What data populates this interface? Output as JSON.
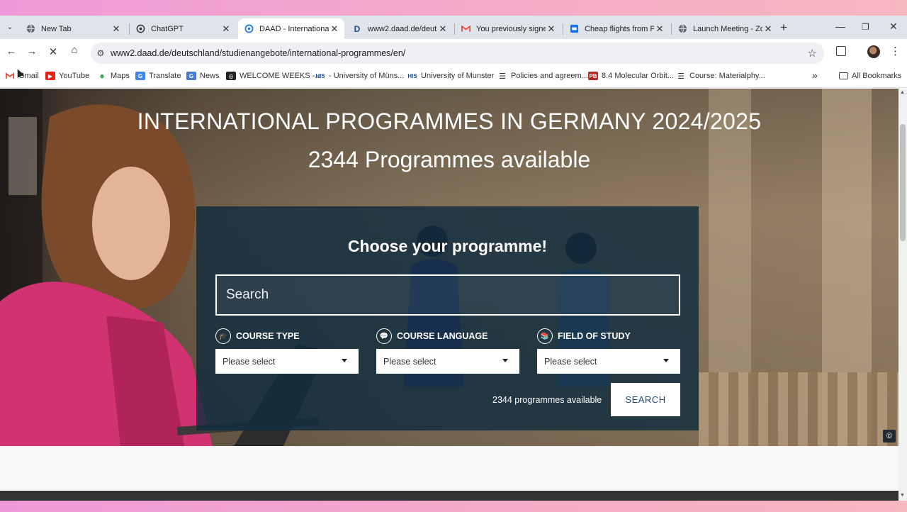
{
  "browser": {
    "tabs": [
      {
        "title": "New Tab",
        "icon": "globe-icon"
      },
      {
        "title": "ChatGPT",
        "icon": "chatgpt-icon"
      },
      {
        "title": "DAAD - International",
        "icon": "daad-icon",
        "active": true
      },
      {
        "title": "www2.daad.de/deuts",
        "icon": "d-icon"
      },
      {
        "title": "You previously signe",
        "icon": "gmail-icon"
      },
      {
        "title": "Cheap flights from P",
        "icon": "flights-icon"
      },
      {
        "title": "Launch Meeting - Zo",
        "icon": "globe-icon"
      }
    ],
    "url": "www2.daad.de/deutschland/studienangebote/international-programmes/en/",
    "bookmarks": [
      {
        "label": "Gmail"
      },
      {
        "label": "YouTube"
      },
      {
        "label": "Maps"
      },
      {
        "label": "Translate"
      },
      {
        "label": "News"
      },
      {
        "label": "WELCOME WEEKS -..."
      },
      {
        "label": "- University of Müns..."
      },
      {
        "label": "University of Munster"
      },
      {
        "label": "Policies and agreem..."
      },
      {
        "label": "8.4 Molecular Orbit..."
      },
      {
        "label": "Course: Materialphy..."
      }
    ],
    "all_bookmarks": "All Bookmarks",
    "more_bookmarks": "»"
  },
  "hero": {
    "title": "INTERNATIONAL PROGRAMMES IN GERMANY 2024/2025",
    "subtitle": "2344 Programmes available"
  },
  "finder": {
    "heading": "Choose your programme!",
    "search_placeholder": "Search",
    "filters": [
      {
        "label": "COURSE TYPE",
        "value": "Please select"
      },
      {
        "label": "COURSE LANGUAGE",
        "value": "Please select"
      },
      {
        "label": "FIELD OF STUDY",
        "value": "Please select"
      }
    ],
    "count_text": "2344 programmes available",
    "search_button": "SEARCH"
  },
  "copyright_symbol": "©"
}
